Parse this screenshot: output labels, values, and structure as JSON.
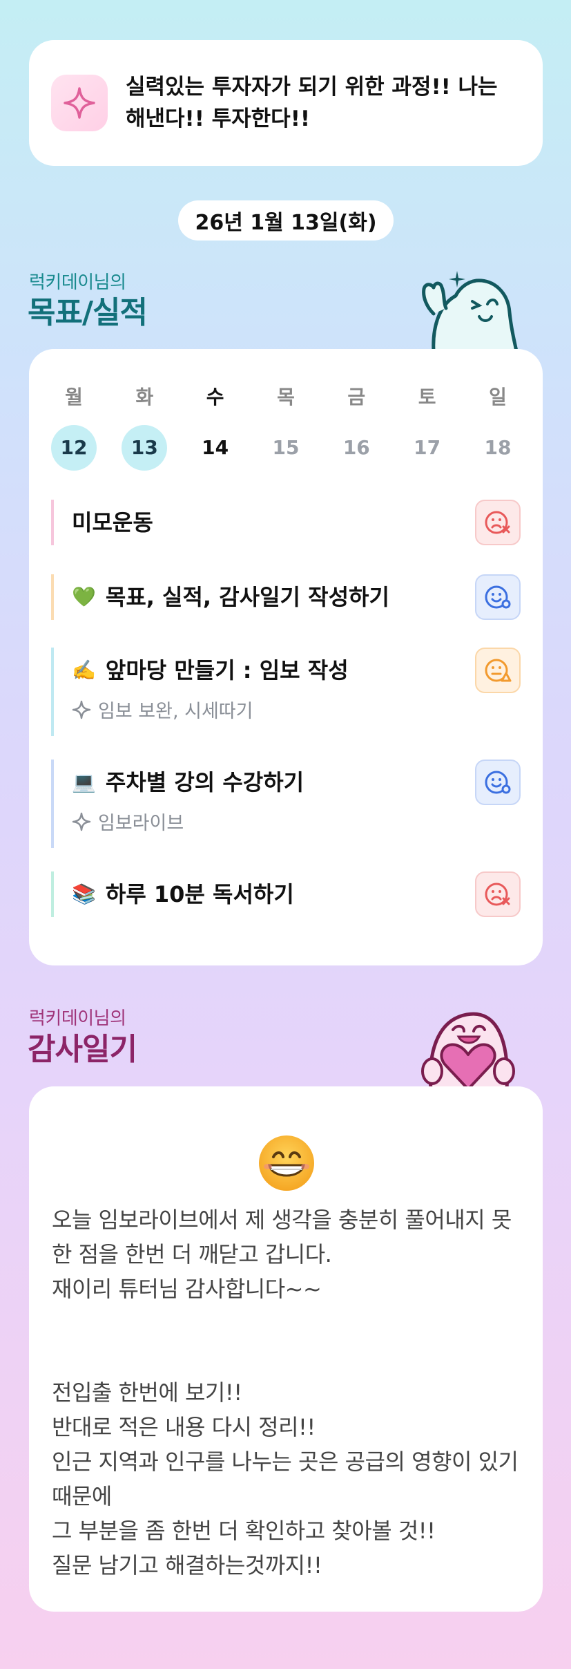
{
  "motto": {
    "icon": "sparkle-icon",
    "text": "실력있는 투자자가 되기 위한 과정!! 나는 해낸다!! 투자한다!!"
  },
  "date": "26년 1월 13일(화)",
  "goals_section": {
    "owner": "럭키데이님의",
    "title": "목표/실적",
    "mascot": "ghost-mascot-waving"
  },
  "week": {
    "days": [
      {
        "name": "월",
        "num": "12",
        "state": "done"
      },
      {
        "name": "화",
        "num": "13",
        "state": "done"
      },
      {
        "name": "수",
        "num": "14",
        "state": "today"
      },
      {
        "name": "목",
        "num": "15",
        "state": "future"
      },
      {
        "name": "금",
        "num": "16",
        "state": "future"
      },
      {
        "name": "토",
        "num": "17",
        "state": "future"
      },
      {
        "name": "일",
        "num": "18",
        "state": "future"
      }
    ]
  },
  "goals": [
    {
      "emoji": "",
      "title": "미모운동",
      "sub": "",
      "status": "sad-x",
      "accent": "#f6c6dc"
    },
    {
      "emoji": "💚",
      "title": "목표, 실적, 감사일기 작성하기",
      "sub": "",
      "status": "smile-o",
      "accent": "#fbdcb2"
    },
    {
      "emoji": "✍️",
      "title": "앞마당 만들기 : 임보 작성",
      "sub": "임보 보완, 시세따기",
      "status": "neutral-triangle",
      "accent": "#bfe9f2"
    },
    {
      "emoji": "💻",
      "title": "주차별 강의 수강하기",
      "sub": "임보라이브",
      "status": "smile-o",
      "accent": "#c9d9f7"
    },
    {
      "emoji": "📚",
      "title": "하루 10분 독서하기",
      "sub": "",
      "status": "sad-x",
      "accent": "#bfeee0"
    }
  ],
  "thanks_section": {
    "owner": "럭키데이님의",
    "title": "감사일기",
    "mascot": "ghost-mascot-heart"
  },
  "thanks": {
    "emoji": "😁",
    "text": "오늘 임보라이브에서 제 생각을 충분히 풀어내지 못한 점을 한번 더 깨닫고 갑니다.\n재이리 튜터님 감사합니다~~\n\n\n전입출 한번에 보기!!\n반대로 적은 내용 다시 정리!!\n인근 지역과 인구를 나누는 곳은 공급의 영향이 있기때문에\n그 부분을 좀 한번 더 확인하고 찾아볼 것!!\n질문 남기고 해결하는것까지!!"
  },
  "colors": {
    "goal_title": "#12707a",
    "thanks_title": "#8c2467",
    "done_day": "#c5eff5",
    "status_red": "#e8595a",
    "status_blue": "#3b6fe0",
    "status_orange": "#f29a2e"
  }
}
